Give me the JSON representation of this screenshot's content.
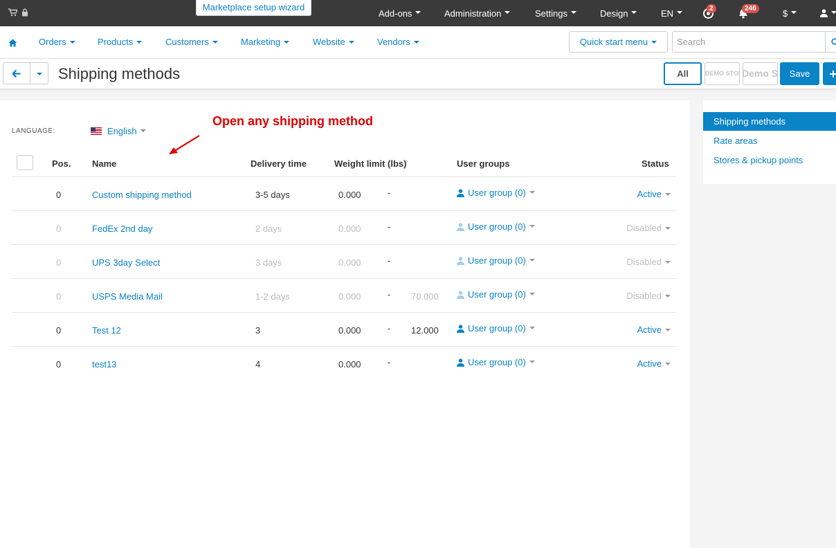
{
  "topbar": {
    "wizard_label": "Marketplace setup wizard",
    "menu": [
      {
        "label": "Add-ons"
      },
      {
        "label": "Administration"
      },
      {
        "label": "Settings"
      },
      {
        "label": "Design"
      },
      {
        "label": "EN"
      },
      {
        "label": "$"
      }
    ],
    "badges": {
      "help": "2",
      "notifications": "246"
    }
  },
  "navbar": {
    "items": [
      {
        "label": "Orders"
      },
      {
        "label": "Products"
      },
      {
        "label": "Customers"
      },
      {
        "label": "Marketing"
      },
      {
        "label": "Website"
      },
      {
        "label": "Vendors"
      }
    ],
    "quick_start": "Quick start menu",
    "search_placeholder": "Search"
  },
  "header": {
    "title": "Shipping methods",
    "all_label": "All",
    "store1_label": "DEMO STORE",
    "store2_label": "Demo Sto",
    "save_label": "Save"
  },
  "language": {
    "label": "LANGUAGE:",
    "value": "English"
  },
  "annotation": "Open any shipping method",
  "table": {
    "headers": {
      "pos": "Pos.",
      "name": "Name",
      "delivery": "Delivery time",
      "weight": "Weight limit (lbs)",
      "user_groups": "User groups",
      "status": "Status"
    },
    "rows": [
      {
        "pos": "0",
        "name": "Custom shipping method",
        "delivery": "3-5 days",
        "weight_min": "0.000",
        "dash": "-",
        "weight_max": "",
        "user_group": "User group (0)",
        "status": "Active",
        "enabled": true
      },
      {
        "pos": "0",
        "name": "FedEx 2nd day",
        "delivery": "2 days",
        "weight_min": "0.000",
        "dash": "-",
        "weight_max": "",
        "user_group": "User group (0)",
        "status": "Disabled",
        "enabled": false
      },
      {
        "pos": "0",
        "name": "UPS 3day Select",
        "delivery": "3 days",
        "weight_min": "0.000",
        "dash": "-",
        "weight_max": "",
        "user_group": "User group (0)",
        "status": "Disabled",
        "enabled": false
      },
      {
        "pos": "0",
        "name": "USPS Media Mail",
        "delivery": "1-2 days",
        "weight_min": "0.000",
        "dash": "-",
        "weight_max": "70.000",
        "user_group": "User group (0)",
        "status": "Disabled",
        "enabled": false
      },
      {
        "pos": "0",
        "name": "Test 12",
        "delivery": "3",
        "weight_min": "0.000",
        "dash": "-",
        "weight_max": "12.000",
        "user_group": "User group (0)",
        "status": "Active",
        "enabled": true
      },
      {
        "pos": "0",
        "name": "test13",
        "delivery": "4",
        "weight_min": "0.000",
        "dash": "-",
        "weight_max": "",
        "user_group": "User group (0)",
        "status": "Active",
        "enabled": true
      }
    ]
  },
  "sidebar": {
    "items": [
      {
        "label": "Shipping methods",
        "active": true
      },
      {
        "label": "Rate areas",
        "active": false
      },
      {
        "label": "Stores & pickup points",
        "active": false
      }
    ]
  },
  "colors": {
    "accent": "#0a83c7",
    "topbar": "#3a3a3a",
    "annotation": "#e00000",
    "badge": "#d9534f"
  }
}
